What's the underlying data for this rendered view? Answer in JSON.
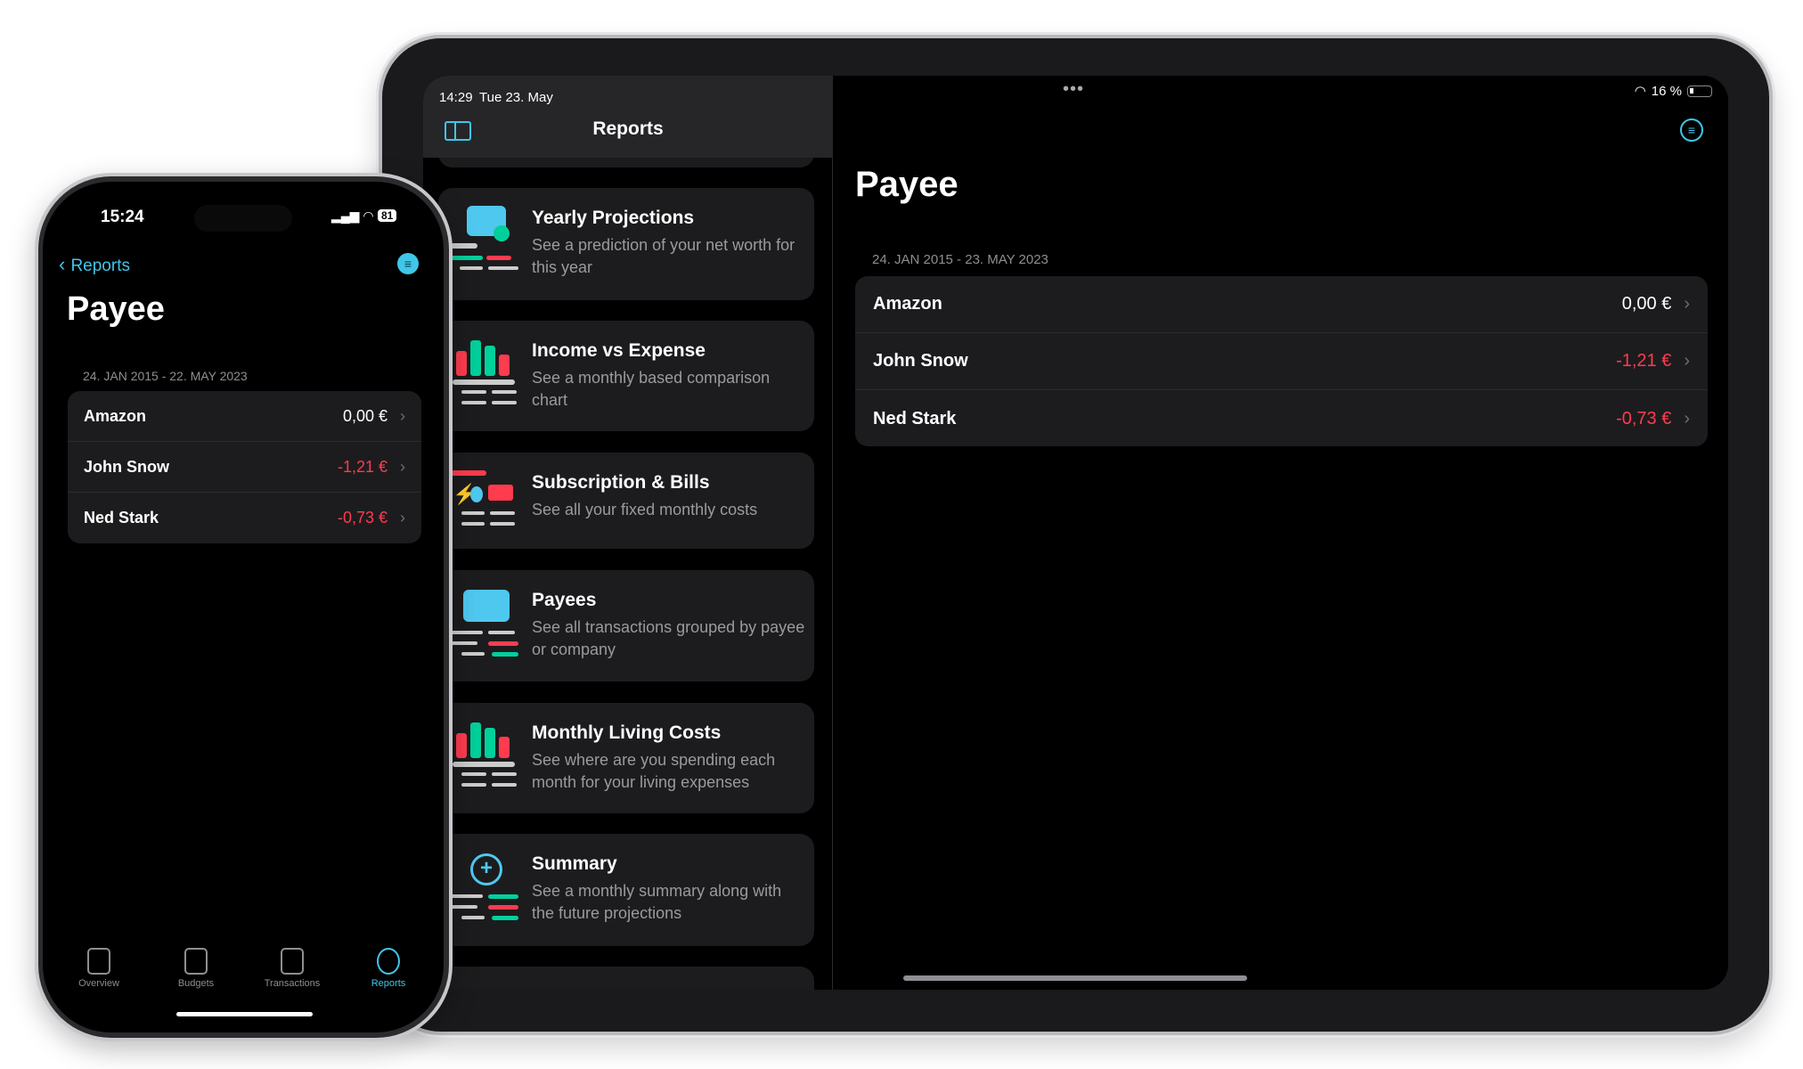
{
  "colors": {
    "accent": "#3fc6e8",
    "negative": "#ff3b4e",
    "green": "#00d09c",
    "card": "#1c1c1e"
  },
  "ipad": {
    "status": {
      "time": "14:29",
      "date": "Tue 23. May",
      "battery": "16 %"
    },
    "sidebar": {
      "title": "Reports",
      "icon": "sidebar-toggle-icon",
      "cards": [
        {
          "title": "Yearly Projections",
          "desc": "See a prediction of your net worth for this year",
          "icon": "calendar-clock-icon"
        },
        {
          "title": "Income vs Expense",
          "desc": "See a monthly based comparison chart",
          "icon": "bar-chart-icon"
        },
        {
          "title": "Subscription & Bills",
          "desc": "See all your fixed monthly costs",
          "icon": "bills-icon"
        },
        {
          "title": "Payees",
          "desc": "See all transactions grouped by payee or company",
          "icon": "payee-card-icon"
        },
        {
          "title": "Monthly Living Costs",
          "desc": "See where are you spending each month for your living expenses",
          "icon": "bar-chart-icon"
        },
        {
          "title": "Summary",
          "desc": "See a monthly summary along with the future projections",
          "icon": "plus-circle-icon"
        }
      ]
    },
    "detail": {
      "title": "Payee",
      "range": "24. JAN 2015 - 23. MAY 2023",
      "rows": [
        {
          "name": "Amazon",
          "amount": "0,00 €",
          "negative": false
        },
        {
          "name": "John Snow",
          "amount": "-1,21 €",
          "negative": true
        },
        {
          "name": "Ned Stark",
          "amount": "-0,73 €",
          "negative": true
        }
      ]
    }
  },
  "phone": {
    "status": {
      "time": "15:24",
      "battery": "81"
    },
    "back_label": "Reports",
    "title": "Payee",
    "range": "24. JAN 2015 - 22. MAY 2023",
    "rows": [
      {
        "name": "Amazon",
        "amount": "0,00 €",
        "negative": false
      },
      {
        "name": "John Snow",
        "amount": "-1,21 €",
        "negative": true
      },
      {
        "name": "Ned Stark",
        "amount": "-0,73 €",
        "negative": true
      }
    ],
    "tabs": [
      {
        "label": "Overview",
        "active": false
      },
      {
        "label": "Budgets",
        "active": false
      },
      {
        "label": "Transactions",
        "active": false
      },
      {
        "label": "Reports",
        "active": true
      }
    ]
  }
}
